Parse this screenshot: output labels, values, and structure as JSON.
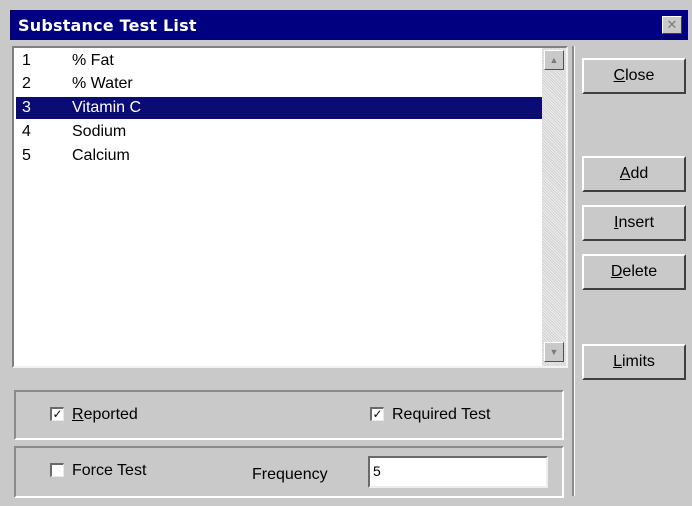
{
  "window": {
    "title": "Substance Test List",
    "close_glyph": "✕"
  },
  "list": {
    "items": [
      {
        "num": "1",
        "name": "% Fat"
      },
      {
        "num": "2",
        "name": "% Water"
      },
      {
        "num": "3",
        "name": "Vitamin C"
      },
      {
        "num": "4",
        "name": "Sodium"
      },
      {
        "num": "5",
        "name": "Calcium"
      }
    ],
    "selected_index": 2,
    "scroll_up_glyph": "▲",
    "scroll_down_glyph": "▼"
  },
  "buttons": {
    "close": {
      "first": "C",
      "rest": "lose"
    },
    "add": {
      "first": "A",
      "rest": "dd"
    },
    "insert": {
      "first": "I",
      "rest": "nsert"
    },
    "delete": {
      "first": "D",
      "rest": "elete"
    },
    "limits": {
      "first": "L",
      "rest": "imits"
    }
  },
  "options": {
    "reported": {
      "first": "R",
      "rest": "eported",
      "checked": true
    },
    "required_test": {
      "label": "Required Test",
      "checked": true
    },
    "force_test": {
      "label": "Force Test",
      "checked": false
    },
    "frequency_label": "Frequency",
    "frequency_value": "5"
  }
}
